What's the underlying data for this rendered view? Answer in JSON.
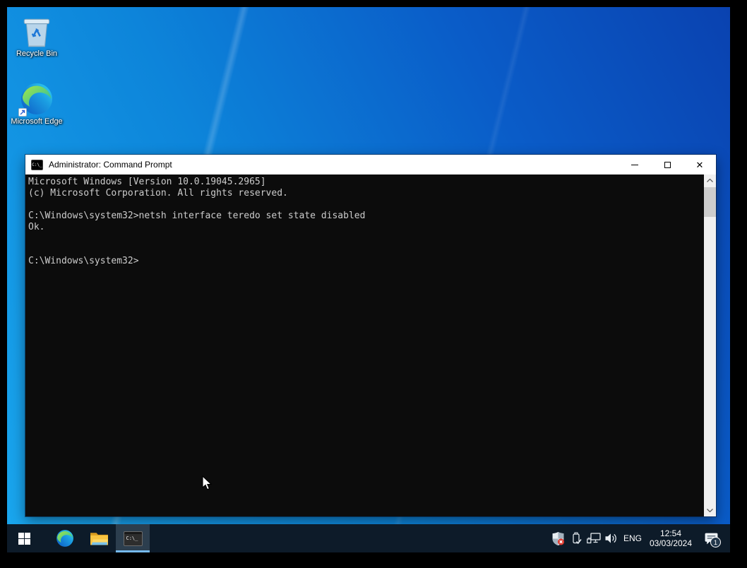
{
  "desktop": {
    "icons": [
      {
        "id": "recycle-bin",
        "label": "Recycle Bin"
      },
      {
        "id": "microsoft-edge",
        "label": "Microsoft Edge"
      }
    ]
  },
  "window": {
    "title": "Administrator: Command Prompt",
    "icon_text": "C:\\_",
    "close_glyph": "✕",
    "console_lines": [
      "Microsoft Windows [Version 10.0.19045.2965]",
      "(c) Microsoft Corporation. All rights reserved.",
      "",
      "C:\\Windows\\system32>netsh interface teredo set state disabled",
      "Ok.",
      "",
      "",
      "C:\\Windows\\system32>"
    ]
  },
  "taskbar": {
    "buttons": [
      "start",
      "microsoft-edge",
      "file-explorer",
      "command-prompt"
    ],
    "active_button": "command-prompt",
    "cmd_tile_text": "C:\\_",
    "tray": {
      "icons": [
        "windows-security",
        "safely-remove-hardware",
        "wired-network",
        "volume"
      ],
      "language": "ENG",
      "time": "12:54",
      "date": "03/03/2024",
      "notification_badge": "1"
    }
  },
  "colors": {
    "desktop_gradient_start": "#1aa7ee",
    "desktop_gradient_mid": "#0d85da",
    "desktop_gradient_end": "#0a42b0",
    "taskbar_bg": "#0d1b29",
    "taskbar_active_bg": "#2c3e4e",
    "taskbar_active_underline": "#76b9ed",
    "console_bg": "#0c0c0c",
    "console_text": "#cccccc",
    "titlebar_bg": "#ffffff",
    "titlebar_text": "#000000",
    "scrollbar_track": "#f0f0f0",
    "scrollbar_thumb": "#cdcdcd",
    "badge_red": "#d93025"
  }
}
